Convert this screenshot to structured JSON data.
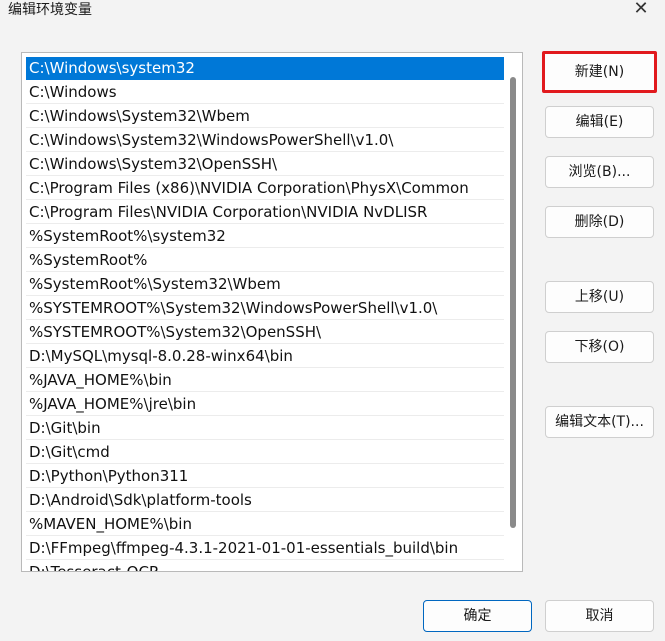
{
  "window": {
    "title": "编辑环境变量",
    "close_glyph": "✕"
  },
  "paths": [
    "C:\\Windows\\system32",
    "C:\\Windows",
    "C:\\Windows\\System32\\Wbem",
    "C:\\Windows\\System32\\WindowsPowerShell\\v1.0\\",
    "C:\\Windows\\System32\\OpenSSH\\",
    "C:\\Program Files (x86)\\NVIDIA Corporation\\PhysX\\Common",
    "C:\\Program Files\\NVIDIA Corporation\\NVIDIA NvDLISR",
    "%SystemRoot%\\system32",
    "%SystemRoot%",
    "%SystemRoot%\\System32\\Wbem",
    "%SYSTEMROOT%\\System32\\WindowsPowerShell\\v1.0\\",
    "%SYSTEMROOT%\\System32\\OpenSSH\\",
    "D:\\MySQL\\mysql-8.0.28-winx64\\bin",
    "%JAVA_HOME%\\bin",
    "%JAVA_HOME%\\jre\\bin",
    "D:\\Git\\bin",
    "D:\\Git\\cmd",
    "D:\\Python\\Python311",
    "D:\\Android\\Sdk\\platform-tools",
    "%MAVEN_HOME%\\bin",
    "D:\\FFmpeg\\ffmpeg-4.3.1-2021-01-01-essentials_build\\bin",
    "D:\\Tesseract-OCR"
  ],
  "selected_index": 0,
  "buttons": {
    "new": "新建(N)",
    "edit": "编辑(E)",
    "browse": "浏览(B)...",
    "delete": "删除(D)",
    "move_up": "上移(U)",
    "move_down": "下移(O)",
    "edit_text": "编辑文本(T)...",
    "ok": "确定",
    "cancel": "取消"
  },
  "colors": {
    "selection": "#0078d7",
    "highlight_border": "#e1191d"
  }
}
